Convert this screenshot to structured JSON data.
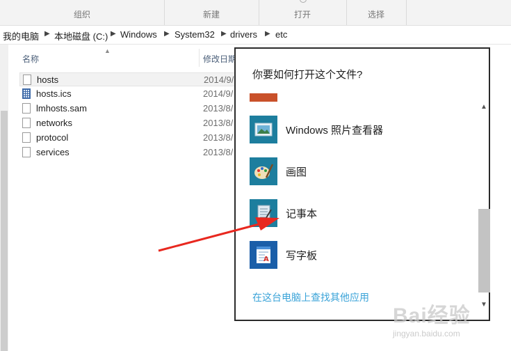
{
  "ribbon": {
    "groups": [
      "组织",
      "新建",
      "打开",
      "选择"
    ]
  },
  "address_bar": {
    "path": [
      "我的电脑",
      "本地磁盘 (C:)",
      "Windows",
      "System32",
      "drivers",
      "etc"
    ]
  },
  "file_list": {
    "columns": [
      "名称",
      "修改日期"
    ],
    "rows": [
      {
        "name": "hosts",
        "date": "2014/9/",
        "icon": "file-icon"
      },
      {
        "name": "hosts.ics",
        "date": "2014/9/",
        "icon": "ics-file-icon"
      },
      {
        "name": "lmhosts.sam",
        "date": "2013/8/",
        "icon": "file-icon"
      },
      {
        "name": "networks",
        "date": "2013/8/",
        "icon": "file-icon"
      },
      {
        "name": "protocol",
        "date": "2013/8/",
        "icon": "file-icon"
      },
      {
        "name": "services",
        "date": "2013/8/",
        "icon": "file-icon"
      }
    ]
  },
  "dialog": {
    "title": "你要如何打开这个文件?",
    "apps": [
      {
        "label": "Windows 照片查看器",
        "icon": "photo-viewer-icon"
      },
      {
        "label": "画图",
        "icon": "paint-icon"
      },
      {
        "label": "记事本",
        "icon": "notepad-icon"
      },
      {
        "label": "写字板",
        "icon": "wordpad-icon"
      }
    ],
    "more_apps_link": "在这台电脑上查找其他应用"
  },
  "watermark": {
    "brand": "Bai经验",
    "url": "jingyan.baidu.com"
  },
  "colors": {
    "tile": "#1d7e9e",
    "link": "#3aa3d8",
    "annotation_arrow": "#e8281f"
  }
}
